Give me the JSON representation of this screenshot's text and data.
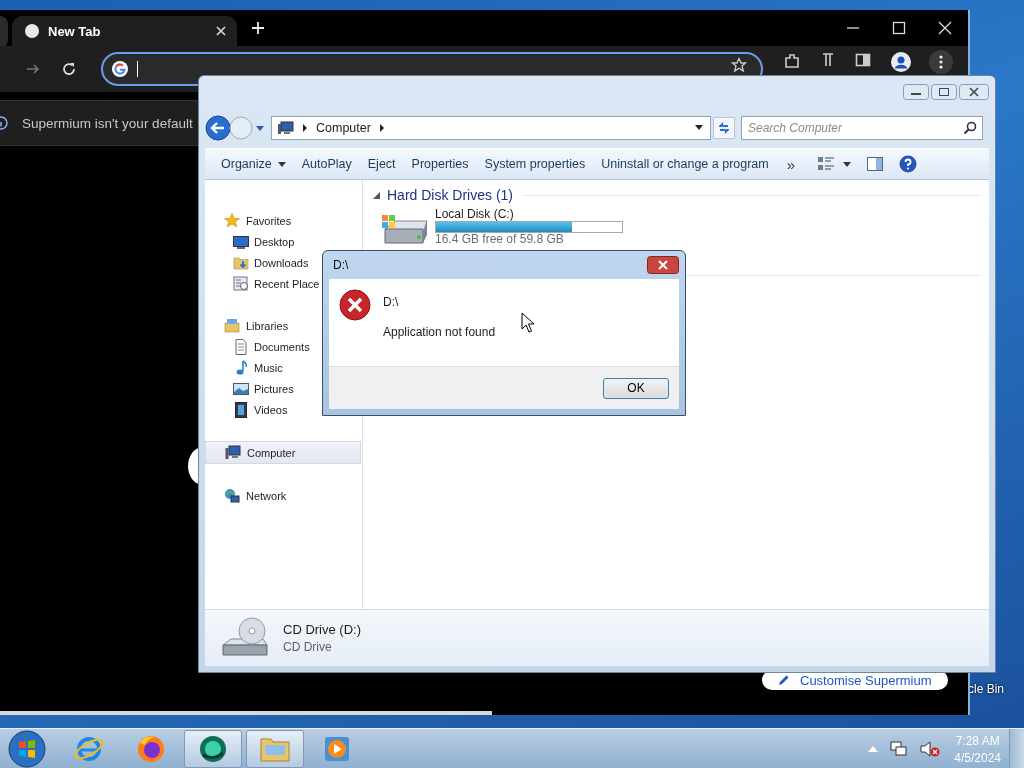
{
  "desktop": {
    "icons": [
      {
        "label": "cle Bin"
      }
    ]
  },
  "browser": {
    "tabs": [
      {
        "title": "New Tab",
        "selected": true
      }
    ],
    "infobar": {
      "text": "Supermium isn't your default"
    },
    "customise_button": {
      "label": "Customise Supermium"
    }
  },
  "explorer": {
    "breadcrumb": [
      "Computer"
    ],
    "search": {
      "placeholder": "Search Computer"
    },
    "toolbar": [
      {
        "kind": "menu",
        "label": "Organize"
      },
      {
        "kind": "button",
        "label": "AutoPlay"
      },
      {
        "kind": "button",
        "label": "Eject"
      },
      {
        "kind": "button",
        "label": "Properties"
      },
      {
        "kind": "button",
        "label": "System properties"
      },
      {
        "kind": "button",
        "label": "Uninstall or change a program"
      },
      {
        "kind": "overflow",
        "label": "»"
      },
      {
        "kind": "view"
      },
      {
        "kind": "pane"
      },
      {
        "kind": "help"
      }
    ],
    "sidebar": [
      {
        "kind": "favorites",
        "label": "Favorites",
        "selected": false,
        "children": [
          {
            "kind": "desktop",
            "label": "Desktop",
            "selected": false
          },
          {
            "kind": "downloads",
            "label": "Downloads",
            "selected": false
          },
          {
            "kind": "recent",
            "label": "Recent Place",
            "selected": false
          }
        ]
      },
      {
        "kind": "libraries",
        "label": "Libraries",
        "selected": false,
        "children": [
          {
            "kind": "documents",
            "label": "Documents",
            "selected": false
          },
          {
            "kind": "music",
            "label": "Music",
            "selected": false
          },
          {
            "kind": "pictures",
            "label": "Pictures",
            "selected": false
          },
          {
            "kind": "videos",
            "label": "Videos",
            "selected": false
          }
        ]
      },
      {
        "kind": "computer",
        "label": "Computer",
        "selected": true
      },
      {
        "kind": "network",
        "label": "Network",
        "selected": false
      }
    ],
    "groups": [
      {
        "title": "Hard Disk Drives (1)",
        "drives": [
          {
            "name": "Local Disk (C:)",
            "level": 0.73,
            "info": "16.4 GB free of 59.8 GB"
          }
        ]
      }
    ],
    "details": {
      "name": "CD Drive (D:)",
      "type": "CD Drive"
    }
  },
  "dialog": {
    "title": "D:\\",
    "heading": "D:\\",
    "message": "Application not found",
    "buttons": [
      "OK"
    ]
  },
  "taskbar": {
    "apps": [
      {
        "kind": "ie",
        "active": false
      },
      {
        "kind": "firefox",
        "active": false
      },
      {
        "kind": "supermium",
        "active": true
      },
      {
        "kind": "explorer",
        "active": true
      },
      {
        "kind": "mediaplayer",
        "active": false
      }
    ],
    "clock": {
      "time": "7:28 AM",
      "date": "4/5/2024"
    }
  }
}
